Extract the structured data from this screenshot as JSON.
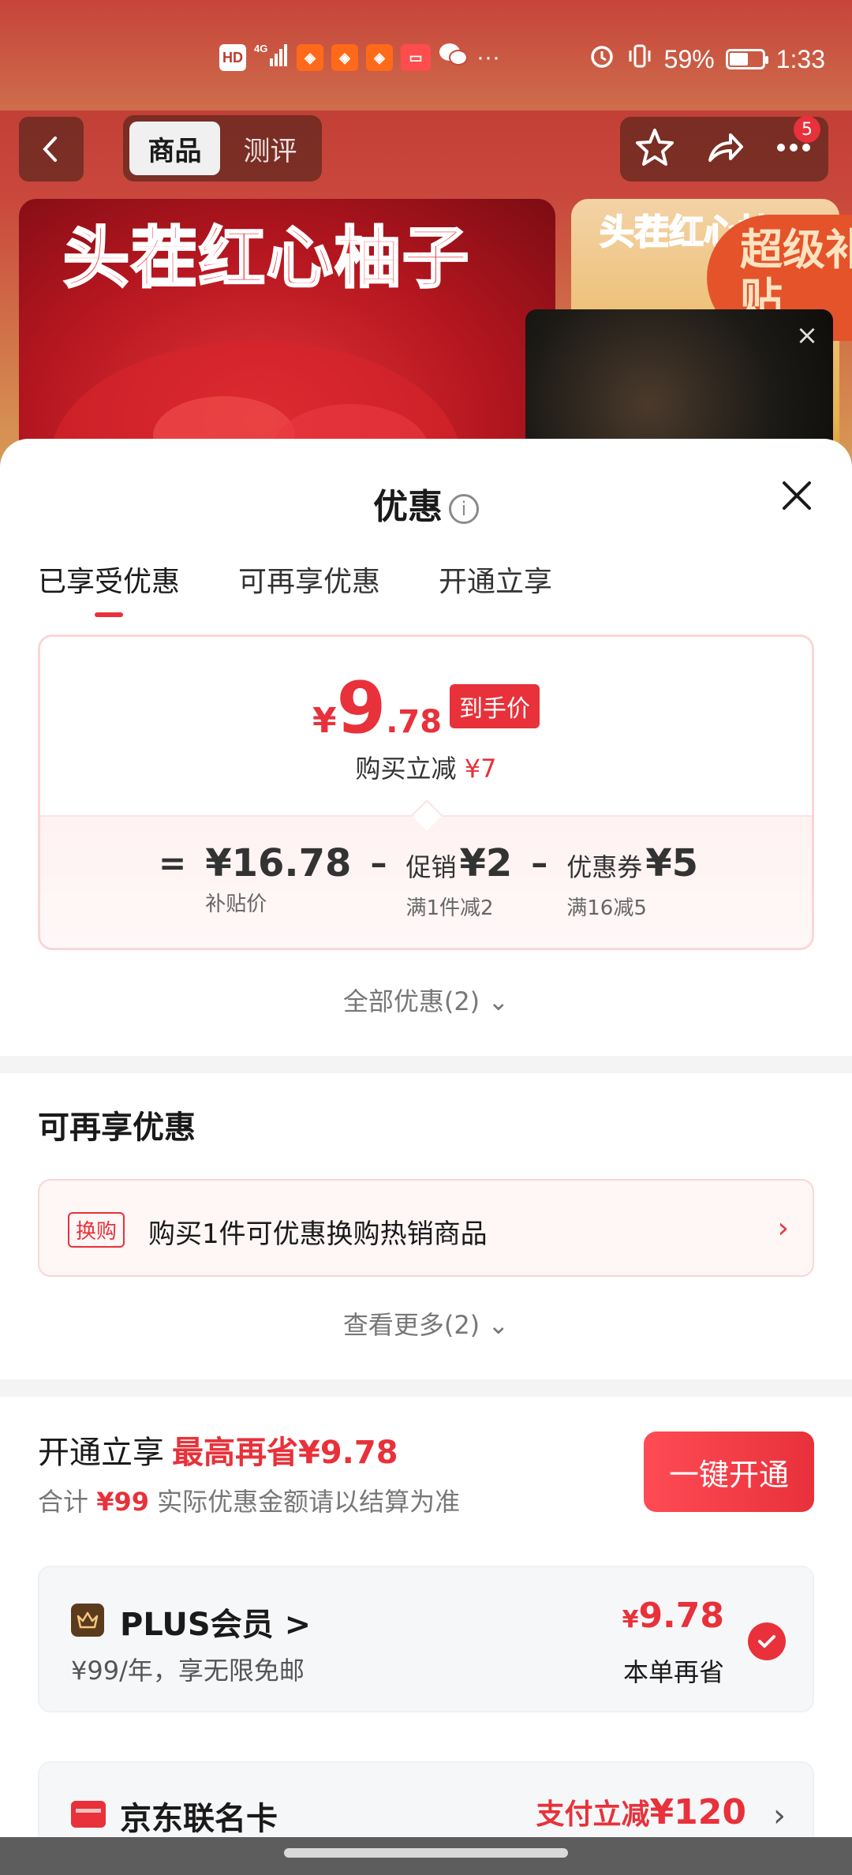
{
  "statusbar": {
    "network": "HD",
    "signal": "4G",
    "more": "···",
    "battery": "59%",
    "battery_level": 0.59,
    "time": "1:33"
  },
  "nav": {
    "tabs": [
      {
        "label": "商品",
        "active": true
      },
      {
        "label": "测评",
        "active": false
      }
    ],
    "badge_count": "5"
  },
  "product": {
    "title": "头茬红心柚子",
    "side_title": "头茬红心柚子",
    "badge": "超级补贴"
  },
  "sheet": {
    "title": "优惠",
    "tabs": [
      {
        "label": "已享受优惠",
        "active": true
      },
      {
        "label": "可再享优惠",
        "active": false
      },
      {
        "label": "开通立享",
        "active": false
      }
    ],
    "final_price": {
      "currency": "¥",
      "integer": "9",
      "decimal": ".78",
      "tag": "到手价",
      "reduce_label": "购买立减",
      "reduce_value": "¥7"
    },
    "breakdown": [
      {
        "op": "=",
        "prefix": "",
        "main": "¥16.78",
        "sub": "补贴价"
      },
      {
        "op": "–",
        "prefix": "促销",
        "main": "¥2",
        "sub": "满1件减2"
      },
      {
        "op": "–",
        "prefix": "优惠券",
        "main": "¥5",
        "sub": "满16减5"
      }
    ],
    "all_offers": "全部优惠(2) ⌄",
    "more_section": {
      "title": "可再享优惠",
      "swap_tag": "换购",
      "swap_text": "购买1件可优惠换购热销商品",
      "see_more": "查看更多(2) ⌄"
    },
    "open_section": {
      "title": "开通立享",
      "title_highlight": "最高再省¥9.78",
      "sub_prefix": "合计",
      "sub_amount": "¥99",
      "sub_suffix": "实际优惠金额请以结算为准",
      "button": "一键开通",
      "plus": {
        "name": "PLUS会员 >",
        "desc": "¥99/年，享无限免邮",
        "save_currency": "¥",
        "save_value": "9.78",
        "save_label": "本单再省"
      },
      "card": {
        "name": "京东联名卡",
        "promo_label": "支付立减",
        "promo_value": "¥120"
      }
    }
  },
  "colors": {
    "accent": "#e8313a",
    "card_bg": "#f6f7f9"
  }
}
